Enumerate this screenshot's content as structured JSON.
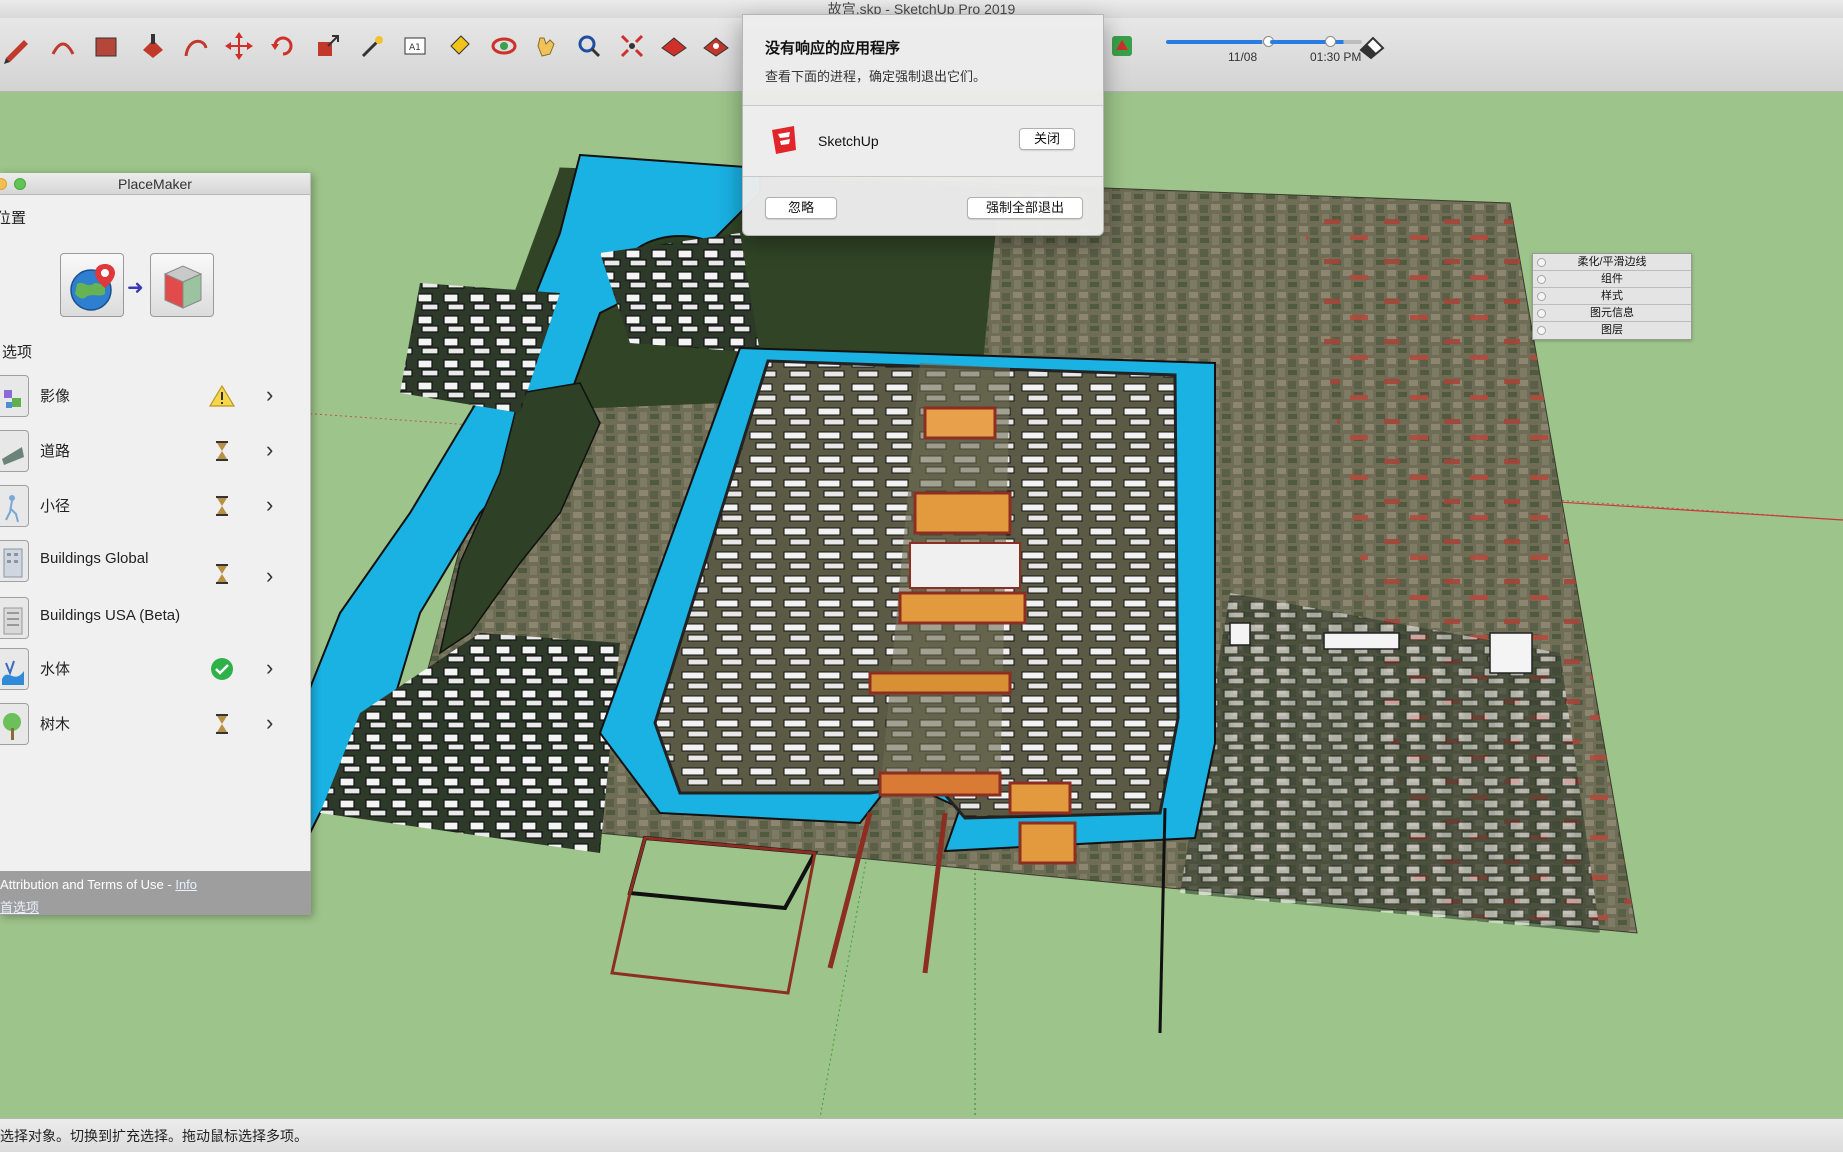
{
  "window": {
    "title": "故宫.skp - SketchUp Pro 2019"
  },
  "toolbar": {
    "tools": [
      "pencil-icon",
      "arc-icon",
      "rectangle-icon",
      "push-pull-icon",
      "follow-me-icon",
      "move-icon",
      "rotate-icon",
      "scale-icon",
      "tape-measure-icon",
      "text-icon",
      "paint-bucket-icon",
      "orbit-icon",
      "pan-icon",
      "zoom-icon",
      "zoom-extents-icon",
      "warehouse-icon",
      "extension-icon",
      "placemaker-icon",
      "eraser-icon"
    ],
    "date_label": "11/08",
    "time_label": "01:30 PM",
    "date_fill": 0.85,
    "time_fill": 0.65
  },
  "tray": {
    "items": [
      "柔化/平滑边线",
      "组件",
      "样式",
      "图元信息",
      "图层"
    ]
  },
  "placemaker": {
    "title": "PlaceMaker",
    "location_heading": "位置",
    "options_heading": "选项",
    "items": [
      {
        "label": "影像",
        "status": "warning"
      },
      {
        "label": "道路",
        "status": "pending"
      },
      {
        "label": "小径",
        "status": "pending"
      },
      {
        "label": "Buildings Global",
        "status": "pending"
      },
      {
        "label": "Buildings USA (Beta)",
        "status": "none"
      },
      {
        "label": "水体",
        "status": "done"
      },
      {
        "label": "树木",
        "status": "pending"
      }
    ],
    "footer_text": "Attribution and Terms of Use - ",
    "footer_link": "Info",
    "footer_link2": "首选项"
  },
  "dialog": {
    "title": "没有响应的应用程序",
    "subtitle": "查看下面的进程，确定强制退出它们。",
    "app_name": "SketchUp",
    "close_label": "关闭",
    "ignore_label": "忽略",
    "force_quit_label": "强制全部退出"
  },
  "statusbar": {
    "text": "选择对象。切换到扩充选择。拖动鼠标选择多项。"
  },
  "colors": {
    "ground": "#9dc48a",
    "water": "#1ab1e3",
    "accent": "#2a7be4",
    "palace_red": "#b83a2c"
  }
}
